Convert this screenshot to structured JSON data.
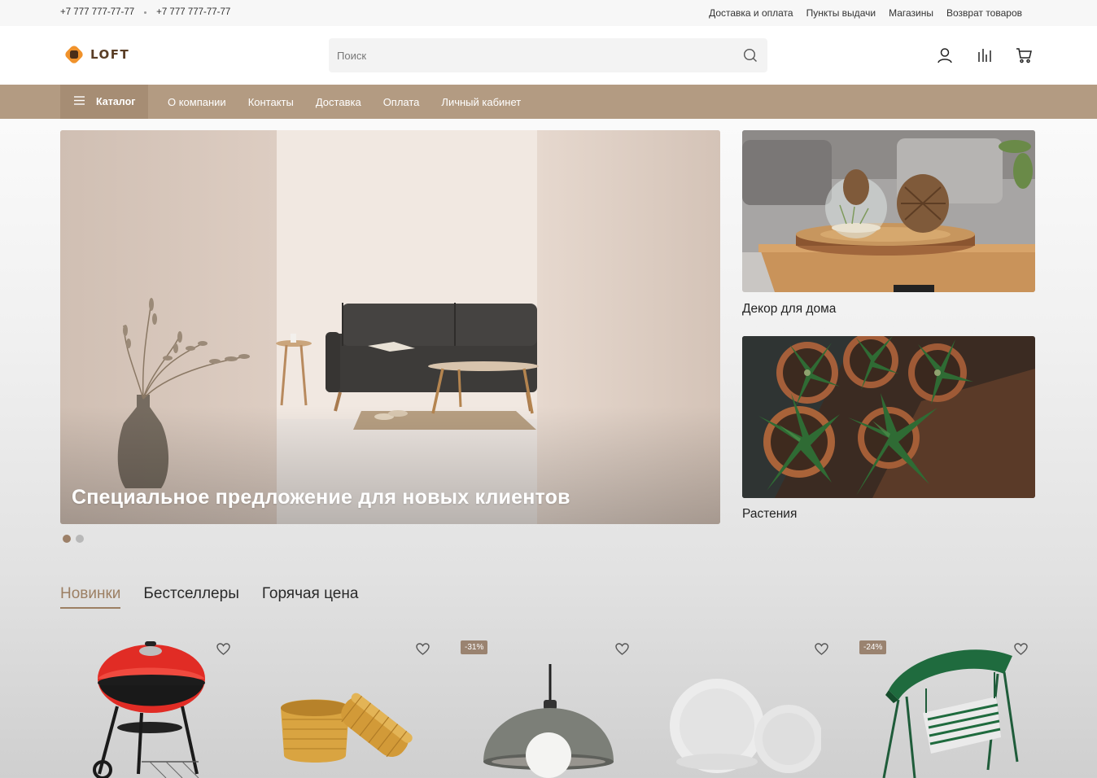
{
  "topbar": {
    "phone1": "+7 777 777-77-77",
    "phone2": "+7 777 777-77-77",
    "links": [
      "Доставка и оплата",
      "Пункты выдачи",
      "Магазины",
      "Возврат товаров"
    ]
  },
  "header": {
    "logo_text": "LOFT",
    "search_placeholder": "Поиск",
    "icons": [
      "user-icon",
      "compare-icon",
      "cart-icon"
    ]
  },
  "nav": {
    "catalog_label": "Каталог",
    "items": [
      "О компании",
      "Контакты",
      "Доставка",
      "Оплата",
      "Личный кабинет"
    ]
  },
  "hero": {
    "caption": "Специальное предложение для новых клиентов",
    "slide_count": 2,
    "active_slide": 1
  },
  "cards": [
    {
      "label": "Декор для дома"
    },
    {
      "label": "Растения"
    }
  ],
  "tabs": [
    {
      "label": "Новинки",
      "active": true
    },
    {
      "label": "Бестселлеры",
      "active": false
    },
    {
      "label": "Горячая цена",
      "active": false
    }
  ],
  "products": [
    {
      "image": "grill",
      "badge": ""
    },
    {
      "image": "wicker-basket",
      "badge": ""
    },
    {
      "image": "pendant-lamp",
      "badge": "-31%"
    },
    {
      "image": "white-plates",
      "badge": ""
    },
    {
      "image": "garden-swing",
      "badge": "-24%"
    }
  ],
  "colors": {
    "accent": "#b39b82",
    "accent_dark": "#9c7f63",
    "logo_orange": "#f0922b"
  }
}
